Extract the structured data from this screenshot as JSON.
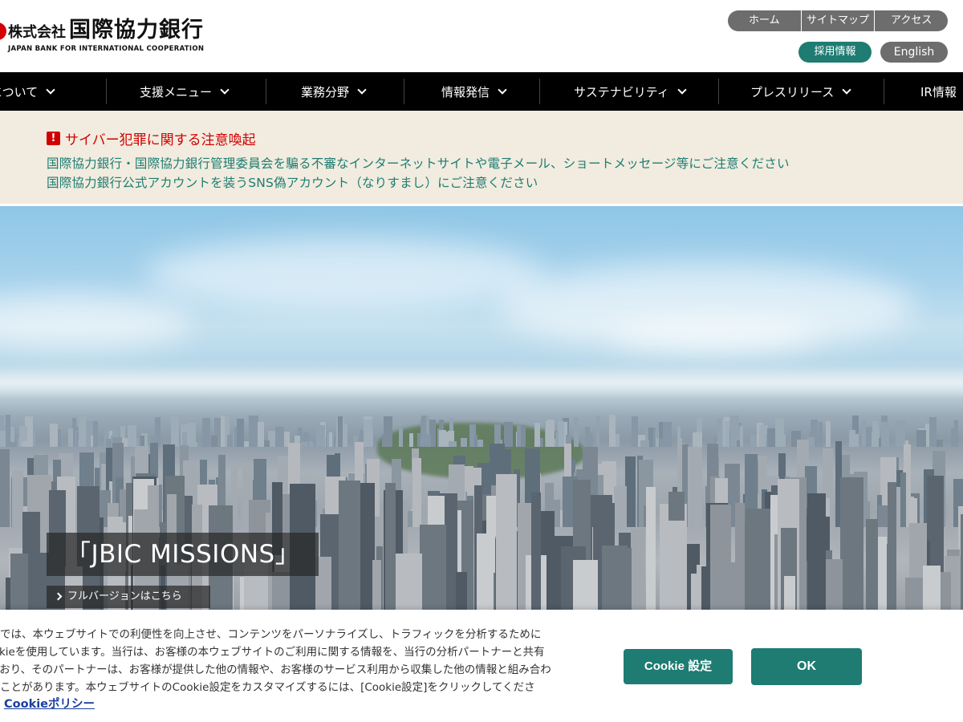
{
  "header": {
    "logo_prefix": "株式会社",
    "logo_name": "国際協力銀行",
    "logo_english": "JAPAN BANK FOR INTERNATIONAL COOPERATION",
    "utility_nav": [
      "ホーム",
      "サイトマップ",
      "アクセス"
    ],
    "recruit_label": "採用情報",
    "english_label": "English"
  },
  "main_nav": {
    "items": [
      "JBICについて",
      "支援メニュー",
      "業務分野",
      "情報発信",
      "サステナビリティ",
      "プレスリリース",
      "IR情報"
    ]
  },
  "alert": {
    "icon": "!",
    "title": "サイバー犯罪に関する注意喚起",
    "links": [
      "国際協力銀行・国際協力銀行管理委員会を騙る不審なインターネットサイトや電子メール、ショートメッセージ等にご注意ください",
      "国際協力銀行公式アカウントを装うSNS偽アカウント（なりすまし）にご注意ください"
    ]
  },
  "hero": {
    "caption": "「JBIC MISSIONS」",
    "link_label": "フルバージョンはこちら"
  },
  "cookie": {
    "lines": [
      "当行では、本ウェブサイトでの利便性を向上させ、コンテンツをパーソナライズし、トラフィックを分析するために",
      "Cookieを使用しています。当行は、お客様の本ウェブサイトのご利用に関する情報を、当行の分析パートナーと共有",
      "しており、そのパートナーは、お客様が提供した他の情報や、お客様のサービス利用から収集した他の情報と組み合わ",
      "せることがあります。本ウェブサイトのCookie設定をカスタマイズするには、[Cookie設定]をクリックしてくださ"
    ],
    "policy_label": "Cookieポリシー",
    "settings_label": "Cookie 設定",
    "ok_label": "OK"
  },
  "colors": {
    "accent": "#1e7c72",
    "alert_red": "#d10000",
    "nav_bg": "#000000",
    "alert_bg": "#f1ecdf",
    "pill_gray": "#6d6d6d"
  }
}
